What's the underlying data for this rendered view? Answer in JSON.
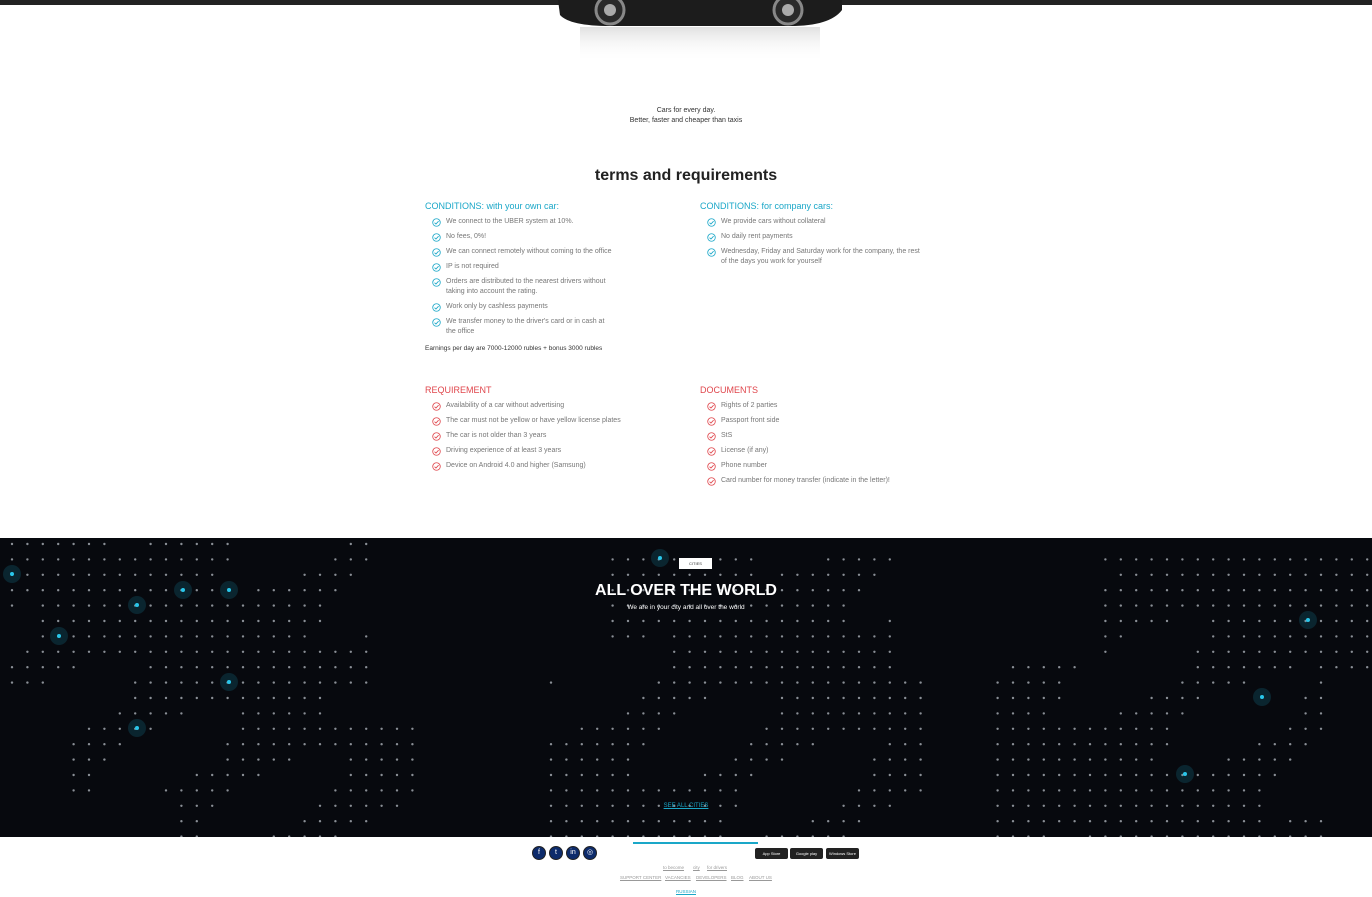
{
  "hero": {
    "tagline_line1": "Cars for every day.",
    "tagline_line2": "Better, faster and cheaper than taxis"
  },
  "terms": {
    "title": "terms and requirements",
    "own_car": {
      "heading": "CONDITIONS: with your own car:",
      "items": [
        "We connect to the UBER system at 10%.",
        "No fees, 0%!",
        "We can connect remotely without coming to the office",
        "IP is not required",
        "Orders are distributed to the nearest drivers without taking into account the rating.",
        "Work only by cashless payments",
        "We transfer money to the driver's card or in cash at the office"
      ],
      "earnings": "Earnings per day are 7000-12000 rubles + bonus 3000 rubles"
    },
    "company_car": {
      "heading": "CONDITIONS: for company cars:",
      "items": [
        "We provide cars without collateral",
        "No daily rent payments",
        "Wednesday, Friday and Saturday work for the company, the rest of the days you work for yourself"
      ]
    },
    "requirement": {
      "heading": "REQUIREMENT",
      "items": [
        "Availability of a car without advertising",
        "The car must not be yellow or have yellow license plates",
        "The car is not older than 3 years",
        "Driving experience of at least 3 years",
        "Device on Android 4.0 and higher (Samsung)"
      ]
    },
    "documents": {
      "heading": "DOCUMENTS",
      "items": [
        "Rights of 2 parties",
        "Passport front side",
        "StS",
        "License (if any)",
        "Phone number",
        "Card number for money transfer (indicate in the letter)!"
      ]
    }
  },
  "world": {
    "tab": "CITIES",
    "title": "ALL OVER THE WORLD",
    "subtitle": "We are in your city and all over the world",
    "see_all": "SEE ALL CITIES",
    "accent": "#1aa7c8"
  },
  "footer": {
    "social": [
      "facebook-icon",
      "twitter-icon",
      "linkedin-icon",
      "instagram-icon"
    ],
    "stores": [
      "App Store",
      "Google play",
      "Windows Store"
    ],
    "links_row1": [
      "to become",
      "city",
      "for drivers"
    ],
    "links_row2": [
      "SUPPORT CENTER",
      "VACANCIES",
      "DEVELOPERS",
      "BLOG",
      "ABOUT US"
    ],
    "language": "RUSSIAN"
  },
  "colors": {
    "teal": "#1aa7c8",
    "red": "#e0464c",
    "dark": "#07090e"
  }
}
